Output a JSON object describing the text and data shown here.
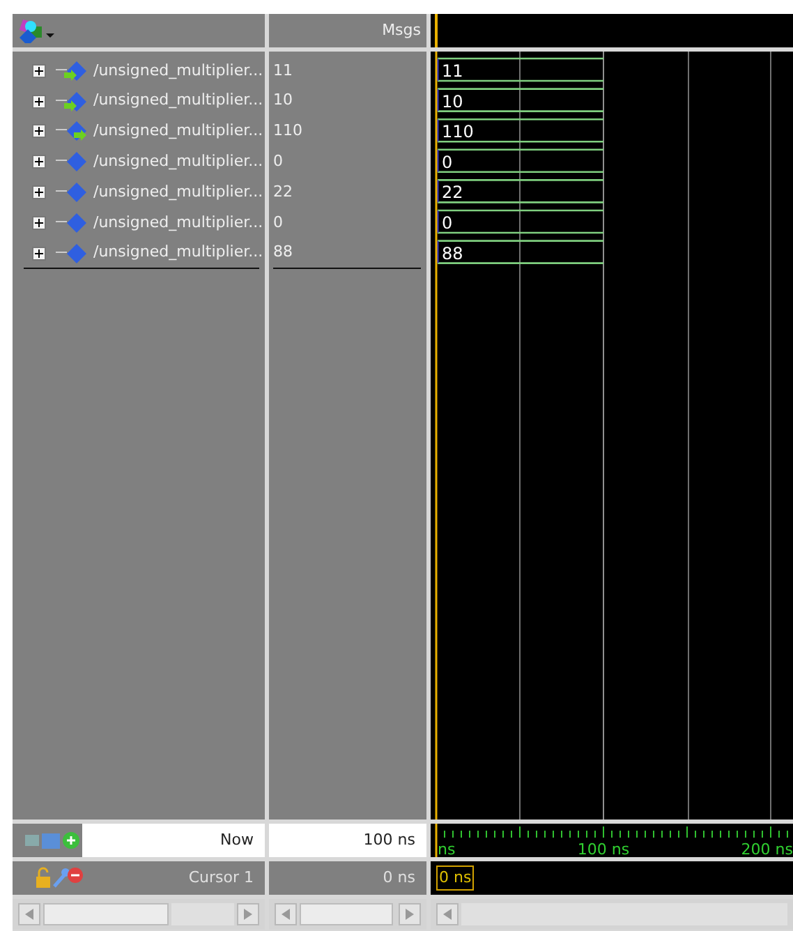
{
  "values_header": "Msgs",
  "signals": [
    {
      "name": "/unsigned_multiplier...",
      "value": "11",
      "wave_value": "11",
      "kind": "in"
    },
    {
      "name": "/unsigned_multiplier...",
      "value": "10",
      "wave_value": "10",
      "kind": "in"
    },
    {
      "name": "/unsigned_multiplier...",
      "value": "110",
      "wave_value": "110",
      "kind": "out"
    },
    {
      "name": "/unsigned_multiplier...",
      "value": "0",
      "wave_value": "0",
      "kind": "internal"
    },
    {
      "name": "/unsigned_multiplier...",
      "value": "22",
      "wave_value": "22",
      "kind": "internal"
    },
    {
      "name": "/unsigned_multiplier...",
      "value": "0",
      "wave_value": "0",
      "kind": "internal"
    },
    {
      "name": "/unsigned_multiplier...",
      "value": "88",
      "wave_value": "88",
      "kind": "internal"
    }
  ],
  "now": {
    "label": "Now",
    "value": "100 ns"
  },
  "cursor": {
    "label": "Cursor 1",
    "value": "0 ns",
    "marker": "0 ns"
  },
  "timeline": {
    "labels": [
      "ns",
      "100 ns",
      "200 ns"
    ]
  }
}
